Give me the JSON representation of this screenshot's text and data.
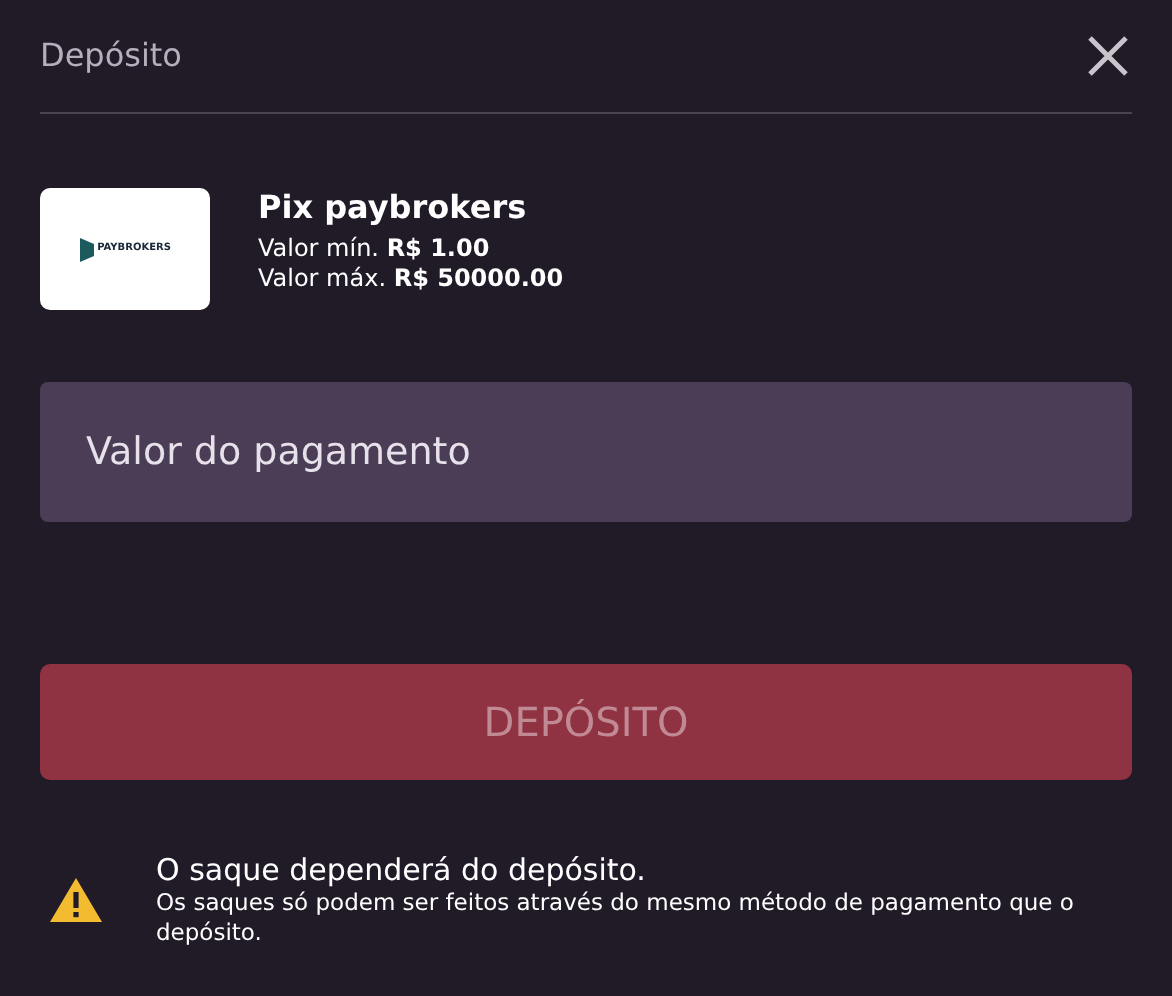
{
  "dialog": {
    "title": "Depósito"
  },
  "method": {
    "logo_text": "PAYBROKERS",
    "name": "Pix paybrokers",
    "min": "Valor mín. **R$ 1.00**",
    "max": "Valor máx. **R$ 50000.00**"
  },
  "amount_field": {
    "placeholder": "Valor do pagamento"
  },
  "submit_button": {
    "label": "DEPÓSITO",
    "disabled": true
  },
  "notice": {
    "title": "O saque dependerá do depósito.",
    "text": "Os saques só podem ser feitos através do mesmo método de pagamento que o depósito."
  }
}
